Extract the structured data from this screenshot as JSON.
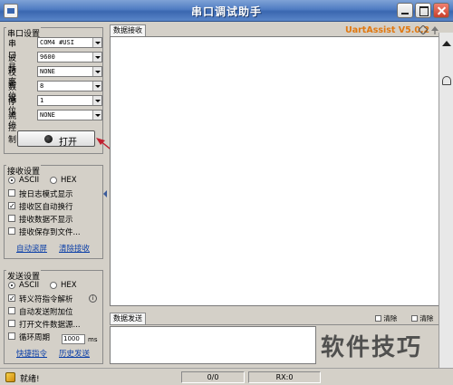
{
  "window": {
    "title": "串口调试助手"
  },
  "serial": {
    "group_title": "串口设置",
    "rows": [
      {
        "label": "串口号",
        "value": "COM4 #USI"
      },
      {
        "label": "波特率",
        "value": "9600"
      },
      {
        "label": "校验位",
        "value": "NONE"
      },
      {
        "label": "数据位",
        "value": "8"
      },
      {
        "label": "停止位",
        "value": "1"
      },
      {
        "label": "流控制",
        "value": "NONE"
      }
    ],
    "open_button": "打开"
  },
  "receive": {
    "group_title": "接收设置",
    "radio_ascii": "ASCII",
    "radio_hex": "HEX",
    "options": [
      {
        "label": "按日志模式显示",
        "checked": false
      },
      {
        "label": "接收区自动换行",
        "checked": true
      },
      {
        "label": "接收数据不显示",
        "checked": false
      },
      {
        "label": "接收保存到文件...",
        "checked": false
      }
    ],
    "link_autoclear": "自动滚屏",
    "link_clear": "清除接收"
  },
  "send": {
    "group_title": "发送设置",
    "radio_ascii": "ASCII",
    "radio_hex": "HEX",
    "options": [
      {
        "label": "转义符指令解析",
        "checked": true
      },
      {
        "label": "自动发送附加位",
        "checked": false
      },
      {
        "label": "打开文件数据源...",
        "checked": false
      },
      {
        "label": "循环周期",
        "checked": false
      }
    ],
    "cycle_value": "1000",
    "cycle_unit": "ms",
    "link_shortcut": "快捷指令",
    "link_history": "历史发送"
  },
  "main": {
    "recv_tab": "数据接收",
    "brand": "UartAssist V5.0.2",
    "send_tab": "数据发送",
    "send_opt1": "清除",
    "send_opt2": "清除"
  },
  "watermark": "软件技巧",
  "status": {
    "ready": "就绪!",
    "count": "0/0",
    "rx": "RX:0"
  },
  "colors": {
    "titlebar": "#4f7cc2",
    "brand": "#e07810",
    "link": "#0b3fa8"
  }
}
